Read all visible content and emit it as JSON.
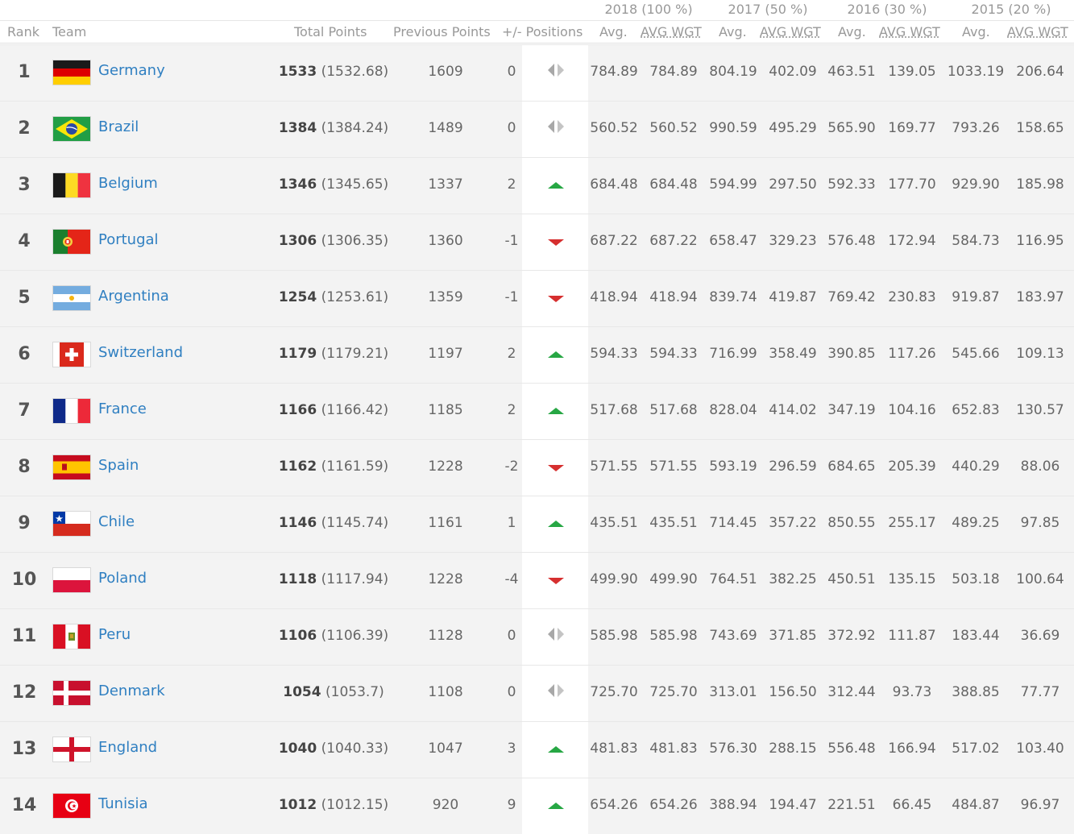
{
  "years": [
    "2018 (100 %)",
    "2017 (50 %)",
    "2016 (30 %)",
    "2015 (20 %)"
  ],
  "columns": {
    "rank": "Rank",
    "team": "Team",
    "total": "Total Points",
    "previous": "Previous Points",
    "positions": "+/- Positions",
    "avg": "Avg.",
    "avgwgt": "AVG WGT"
  },
  "rows": [
    {
      "rank": "1",
      "team": "Germany",
      "flag": "germany",
      "total": "1533",
      "total_exact": "(1532.68)",
      "prev": "1609",
      "change": "0",
      "trend": "same",
      "y2018_avg": "784.89",
      "y2018_wgt": "784.89",
      "y2017_avg": "804.19",
      "y2017_wgt": "402.09",
      "y2016_avg": "463.51",
      "y2016_wgt": "139.05",
      "y2015_avg": "1033.19",
      "y2015_wgt": "206.64"
    },
    {
      "rank": "2",
      "team": "Brazil",
      "flag": "brazil",
      "total": "1384",
      "total_exact": "(1384.24)",
      "prev": "1489",
      "change": "0",
      "trend": "same",
      "y2018_avg": "560.52",
      "y2018_wgt": "560.52",
      "y2017_avg": "990.59",
      "y2017_wgt": "495.29",
      "y2016_avg": "565.90",
      "y2016_wgt": "169.77",
      "y2015_avg": "793.26",
      "y2015_wgt": "158.65"
    },
    {
      "rank": "3",
      "team": "Belgium",
      "flag": "belgium",
      "total": "1346",
      "total_exact": "(1345.65)",
      "prev": "1337",
      "change": "2",
      "trend": "up",
      "y2018_avg": "684.48",
      "y2018_wgt": "684.48",
      "y2017_avg": "594.99",
      "y2017_wgt": "297.50",
      "y2016_avg": "592.33",
      "y2016_wgt": "177.70",
      "y2015_avg": "929.90",
      "y2015_wgt": "185.98"
    },
    {
      "rank": "4",
      "team": "Portugal",
      "flag": "portugal",
      "total": "1306",
      "total_exact": "(1306.35)",
      "prev": "1360",
      "change": "-1",
      "trend": "down",
      "y2018_avg": "687.22",
      "y2018_wgt": "687.22",
      "y2017_avg": "658.47",
      "y2017_wgt": "329.23",
      "y2016_avg": "576.48",
      "y2016_wgt": "172.94",
      "y2015_avg": "584.73",
      "y2015_wgt": "116.95"
    },
    {
      "rank": "5",
      "team": "Argentina",
      "flag": "argentina",
      "total": "1254",
      "total_exact": "(1253.61)",
      "prev": "1359",
      "change": "-1",
      "trend": "down",
      "y2018_avg": "418.94",
      "y2018_wgt": "418.94",
      "y2017_avg": "839.74",
      "y2017_wgt": "419.87",
      "y2016_avg": "769.42",
      "y2016_wgt": "230.83",
      "y2015_avg": "919.87",
      "y2015_wgt": "183.97"
    },
    {
      "rank": "6",
      "team": "Switzerland",
      "flag": "switzerland",
      "total": "1179",
      "total_exact": "(1179.21)",
      "prev": "1197",
      "change": "2",
      "trend": "up",
      "y2018_avg": "594.33",
      "y2018_wgt": "594.33",
      "y2017_avg": "716.99",
      "y2017_wgt": "358.49",
      "y2016_avg": "390.85",
      "y2016_wgt": "117.26",
      "y2015_avg": "545.66",
      "y2015_wgt": "109.13"
    },
    {
      "rank": "7",
      "team": "France",
      "flag": "france",
      "total": "1166",
      "total_exact": "(1166.42)",
      "prev": "1185",
      "change": "2",
      "trend": "up",
      "y2018_avg": "517.68",
      "y2018_wgt": "517.68",
      "y2017_avg": "828.04",
      "y2017_wgt": "414.02",
      "y2016_avg": "347.19",
      "y2016_wgt": "104.16",
      "y2015_avg": "652.83",
      "y2015_wgt": "130.57"
    },
    {
      "rank": "8",
      "team": "Spain",
      "flag": "spain",
      "total": "1162",
      "total_exact": "(1161.59)",
      "prev": "1228",
      "change": "-2",
      "trend": "down",
      "y2018_avg": "571.55",
      "y2018_wgt": "571.55",
      "y2017_avg": "593.19",
      "y2017_wgt": "296.59",
      "y2016_avg": "684.65",
      "y2016_wgt": "205.39",
      "y2015_avg": "440.29",
      "y2015_wgt": "88.06"
    },
    {
      "rank": "9",
      "team": "Chile",
      "flag": "chile",
      "total": "1146",
      "total_exact": "(1145.74)",
      "prev": "1161",
      "change": "1",
      "trend": "up",
      "y2018_avg": "435.51",
      "y2018_wgt": "435.51",
      "y2017_avg": "714.45",
      "y2017_wgt": "357.22",
      "y2016_avg": "850.55",
      "y2016_wgt": "255.17",
      "y2015_avg": "489.25",
      "y2015_wgt": "97.85"
    },
    {
      "rank": "10",
      "team": "Poland",
      "flag": "poland",
      "total": "1118",
      "total_exact": "(1117.94)",
      "prev": "1228",
      "change": "-4",
      "trend": "down",
      "y2018_avg": "499.90",
      "y2018_wgt": "499.90",
      "y2017_avg": "764.51",
      "y2017_wgt": "382.25",
      "y2016_avg": "450.51",
      "y2016_wgt": "135.15",
      "y2015_avg": "503.18",
      "y2015_wgt": "100.64"
    },
    {
      "rank": "11",
      "team": "Peru",
      "flag": "peru",
      "total": "1106",
      "total_exact": "(1106.39)",
      "prev": "1128",
      "change": "0",
      "trend": "same",
      "y2018_avg": "585.98",
      "y2018_wgt": "585.98",
      "y2017_avg": "743.69",
      "y2017_wgt": "371.85",
      "y2016_avg": "372.92",
      "y2016_wgt": "111.87",
      "y2015_avg": "183.44",
      "y2015_wgt": "36.69"
    },
    {
      "rank": "12",
      "team": "Denmark",
      "flag": "denmark",
      "total": "1054",
      "total_exact": "(1053.7)",
      "prev": "1108",
      "change": "0",
      "trend": "same",
      "y2018_avg": "725.70",
      "y2018_wgt": "725.70",
      "y2017_avg": "313.01",
      "y2017_wgt": "156.50",
      "y2016_avg": "312.44",
      "y2016_wgt": "93.73",
      "y2015_avg": "388.85",
      "y2015_wgt": "77.77"
    },
    {
      "rank": "13",
      "team": "England",
      "flag": "england",
      "total": "1040",
      "total_exact": "(1040.33)",
      "prev": "1047",
      "change": "3",
      "trend": "up",
      "y2018_avg": "481.83",
      "y2018_wgt": "481.83",
      "y2017_avg": "576.30",
      "y2017_wgt": "288.15",
      "y2016_avg": "556.48",
      "y2016_wgt": "166.94",
      "y2015_avg": "517.02",
      "y2015_wgt": "103.40"
    },
    {
      "rank": "14",
      "team": "Tunisia",
      "flag": "tunisia",
      "total": "1012",
      "total_exact": "(1012.15)",
      "prev": "920",
      "change": "9",
      "trend": "up",
      "y2018_avg": "654.26",
      "y2018_wgt": "654.26",
      "y2017_avg": "388.94",
      "y2017_wgt": "194.47",
      "y2016_avg": "221.51",
      "y2016_wgt": "66.45",
      "y2015_avg": "484.87",
      "y2015_wgt": "96.97"
    }
  ],
  "colors": {
    "link": "#2f7fc1",
    "up": "#27a744",
    "down": "#d62f2f",
    "same": "#999999",
    "row_bg": "#f3f3f3"
  }
}
